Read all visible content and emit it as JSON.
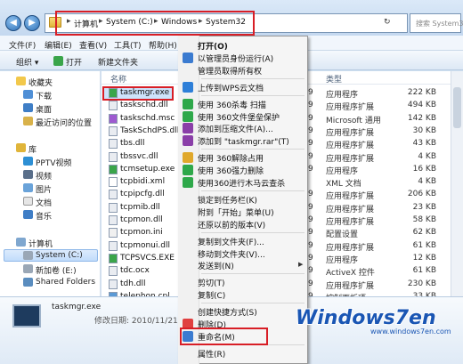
{
  "address": {
    "crumbs": [
      "计算机",
      "System (C:)",
      "Windows",
      "System32"
    ],
    "search_placeholder": "搜索 System32"
  },
  "menu": [
    "文件(F)",
    "编辑(E)",
    "查看(V)",
    "工具(T)",
    "帮助(H)"
  ],
  "toolbar": {
    "organize": "组织 ▾",
    "open": "打开",
    "new_folder": "新建文件夹"
  },
  "nav": {
    "favorites": "收藏夹",
    "favorites_items": [
      "下载",
      "桌面",
      "最近访问的位置"
    ],
    "library": "库",
    "library_items": [
      "PPTV视频",
      "视频",
      "图片",
      "文档",
      "音乐"
    ],
    "computer": "计算机",
    "computer_items": [
      "System (C:)",
      "新加卷 (E:)",
      "Shared Folders"
    ]
  },
  "columns": {
    "name": "名称",
    "type": "类型"
  },
  "files": [
    {
      "name": "taskmgr.exe",
      "num": "9",
      "type": "应用程序",
      "size": "222 KB"
    },
    {
      "name": "taskschd.dll",
      "num": "9",
      "type": "应用程序扩展",
      "size": "494 KB"
    },
    {
      "name": "taskschd.msc",
      "num": "9",
      "type": "Microsoft 通用",
      "size": "142 KB"
    },
    {
      "name": "TaskSchdPS.dll",
      "num": "9",
      "type": "应用程序扩展",
      "size": "30 KB"
    },
    {
      "name": "tbs.dll",
      "num": "9",
      "type": "应用程序扩展",
      "size": "43 KB"
    },
    {
      "name": "tbssvc.dll",
      "num": "9",
      "type": "应用程序扩展",
      "size": "4 KB"
    },
    {
      "name": "tcmsetup.exe",
      "num": "9",
      "type": "应用程序",
      "size": "16 KB"
    },
    {
      "name": "tcpbidi.xml",
      "num": "",
      "type": "XML 文档",
      "size": "4 KB"
    },
    {
      "name": "tcpipcfg.dll",
      "num": "9",
      "type": "应用程序扩展",
      "size": "206 KB"
    },
    {
      "name": "tcpmib.dll",
      "num": "9",
      "type": "应用程序扩展",
      "size": "23 KB"
    },
    {
      "name": "tcpmon.dll",
      "num": "9",
      "type": "应用程序扩展",
      "size": "58 KB"
    },
    {
      "name": "tcpmon.ini",
      "num": "9",
      "type": "配置设置",
      "size": "62 KB"
    },
    {
      "name": "tcpmonui.dll",
      "num": "9",
      "type": "应用程序扩展",
      "size": "61 KB"
    },
    {
      "name": "TCPSVCS.EXE",
      "num": "9",
      "type": "应用程序",
      "size": "12 KB"
    },
    {
      "name": "tdc.ocx",
      "num": "9",
      "type": "ActiveX 控件",
      "size": "61 KB"
    },
    {
      "name": "tdh.dll",
      "num": "9",
      "type": "应用程序扩展",
      "size": "230 KB"
    },
    {
      "name": "telephon.cpl",
      "num": "9",
      "type": "控制面板项",
      "size": "33 KB"
    }
  ],
  "details": {
    "filename": "taskmgr.exe",
    "line": "修改日期: 2010/11/21 5:29"
  },
  "context_menu": [
    {
      "label": "打开(O)",
      "bold": true
    },
    {
      "label": "以管理员身份运行(A)"
    },
    {
      "label": "管理员取得所有权"
    },
    {
      "sep": true
    },
    {
      "label": "上传到WPS云文档"
    },
    {
      "sep": true
    },
    {
      "label": "使用 360杀毒 扫描"
    },
    {
      "label": "使用 360文件堡垒保护"
    },
    {
      "label": "添加到压缩文件(A)..."
    },
    {
      "label": "添加到 \"taskmgr.rar\"(T)"
    },
    {
      "sep": true
    },
    {
      "label": "使用 360解除占用"
    },
    {
      "label": "使用 360强力删除"
    },
    {
      "label": "使用360进行木马云查杀"
    },
    {
      "sep": true
    },
    {
      "label": "锁定到任务栏(K)"
    },
    {
      "label": "附到「开始」菜单(U)"
    },
    {
      "label": "还原以前的版本(V)"
    },
    {
      "sep": true
    },
    {
      "label": "复制到文件夹(F)..."
    },
    {
      "label": "移动到文件夹(V)..."
    },
    {
      "label": "发送到(N)",
      "submenu": true
    },
    {
      "sep": true
    },
    {
      "label": "剪切(T)"
    },
    {
      "label": "复制(C)"
    },
    {
      "sep": true
    },
    {
      "label": "创建快捷方式(S)"
    },
    {
      "label": "删除(D)"
    },
    {
      "label": "重命名(M)"
    },
    {
      "sep": true
    },
    {
      "label": "属性(R)"
    }
  ],
  "watermark": {
    "brand": "Windows7en",
    "url": "www.windows7en.com"
  },
  "colors": {
    "highlight_red": "#d81e26",
    "selection_blue": "#cde3fb",
    "watermark_blue": "#1a56b4"
  }
}
